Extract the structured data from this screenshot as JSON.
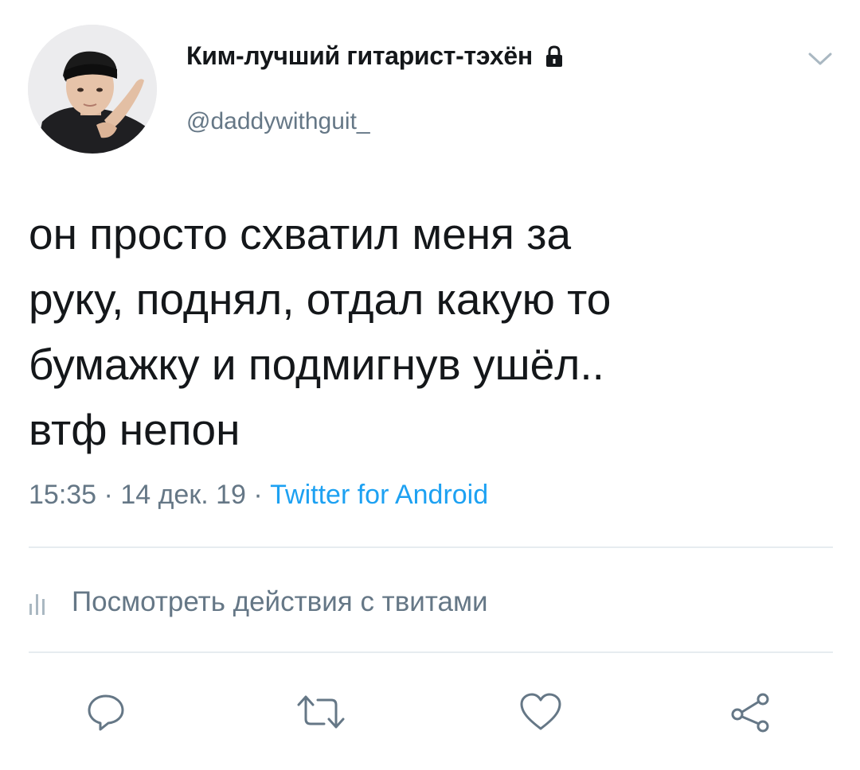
{
  "header": {
    "display_name": "Ким-лучший гитарист-тэхён",
    "handle": "@daddywithguit_",
    "lock_icon": "lock-icon",
    "menu_icon": "chevron-down-icon"
  },
  "tweet": {
    "text": "он просто схватил меня за\nруку, поднял, отдал какую то\nбумажку и подмигнув ушёл..\nвтф непон",
    "time": "15:35",
    "separator_1": " · ",
    "date": "14 дек. 19",
    "separator_2": " · ",
    "source": "Twitter for Android"
  },
  "analytics": {
    "icon": "analytics-icon",
    "label": "Посмотреть действия с твитами"
  },
  "actions": {
    "reply_icon": "reply-icon",
    "retweet_icon": "retweet-icon",
    "like_icon": "heart-icon",
    "share_icon": "share-icon"
  },
  "colors": {
    "text": "#14171a",
    "secondary": "#657786",
    "link": "#1da1f2",
    "divider": "#e6ecf0"
  }
}
